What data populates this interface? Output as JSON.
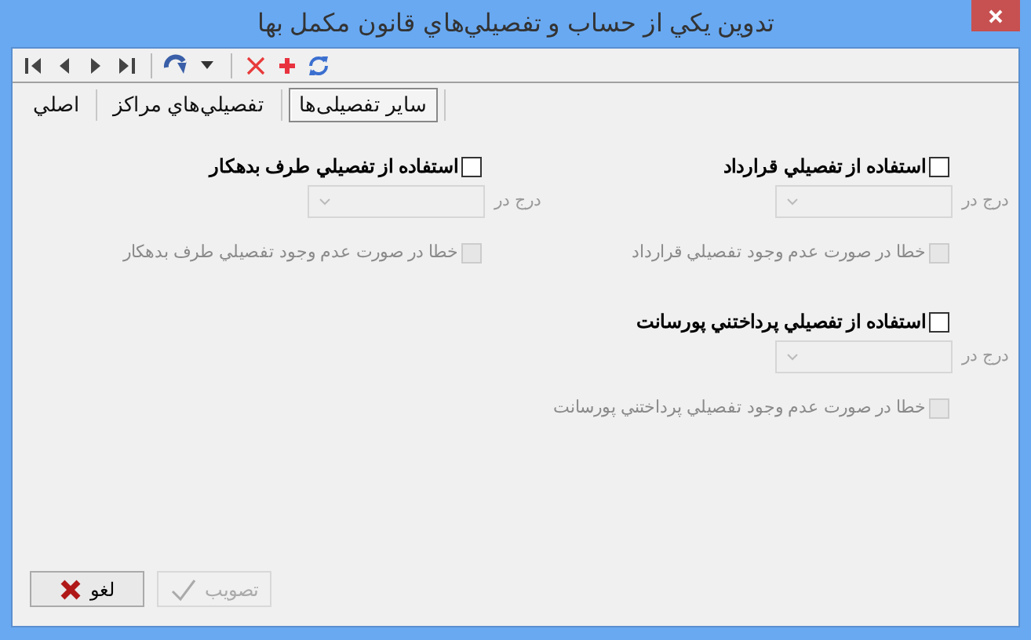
{
  "window": {
    "title": "تدوين يكي از حساب و تفصيلي‌هاي قانون مكمل بها"
  },
  "toolbar": [
    {
      "kind": "first"
    },
    {
      "kind": "prev"
    },
    {
      "kind": "next"
    },
    {
      "kind": "last"
    },
    {
      "kind": "sep"
    },
    {
      "kind": "redo"
    },
    {
      "kind": "dropdown"
    },
    {
      "kind": "sep"
    },
    {
      "kind": "delete"
    },
    {
      "kind": "add"
    },
    {
      "kind": "refresh"
    }
  ],
  "tabs": [
    {
      "label": "سایر تفصیلی‌ها",
      "selected": true
    },
    {
      "label": "تفصيلي‌هاي مراكز",
      "selected": false
    },
    {
      "label": "اصلي",
      "selected": false
    }
  ],
  "columns": [
    [
      {
        "use": {
          "label": "استفاده از تفصيلي قرارداد",
          "checked": false
        },
        "insert_label": "درج در",
        "dropdown": {
          "disabled": true
        },
        "error": {
          "label": "خطا در صورت عدم وجود تفصيلي قرارداد",
          "checked": false,
          "disabled": true
        }
      },
      {
        "use": {
          "label": "استفاده از تفصيلي پرداختني پورسانت",
          "checked": false
        },
        "insert_label": "درج در",
        "dropdown": {
          "disabled": true
        },
        "error": {
          "label": "خطا در صورت عدم وجود تفصيلي پرداختني پورسانت",
          "checked": false,
          "disabled": true
        }
      }
    ],
    [
      {
        "use": {
          "label": "استفاده از تفصيلي طرف بدهكار",
          "checked": false
        },
        "insert_label": "درج در",
        "dropdown": {
          "disabled": true
        },
        "error": {
          "label": "خطا در صورت عدم وجود تفصيلي طرف بدهكار",
          "checked": false,
          "disabled": true
        }
      }
    ]
  ],
  "buttons": [
    {
      "kind": "approve",
      "label": "تصويب",
      "disabled": true
    },
    {
      "kind": "cancel",
      "label": "لغو",
      "disabled": false
    }
  ]
}
